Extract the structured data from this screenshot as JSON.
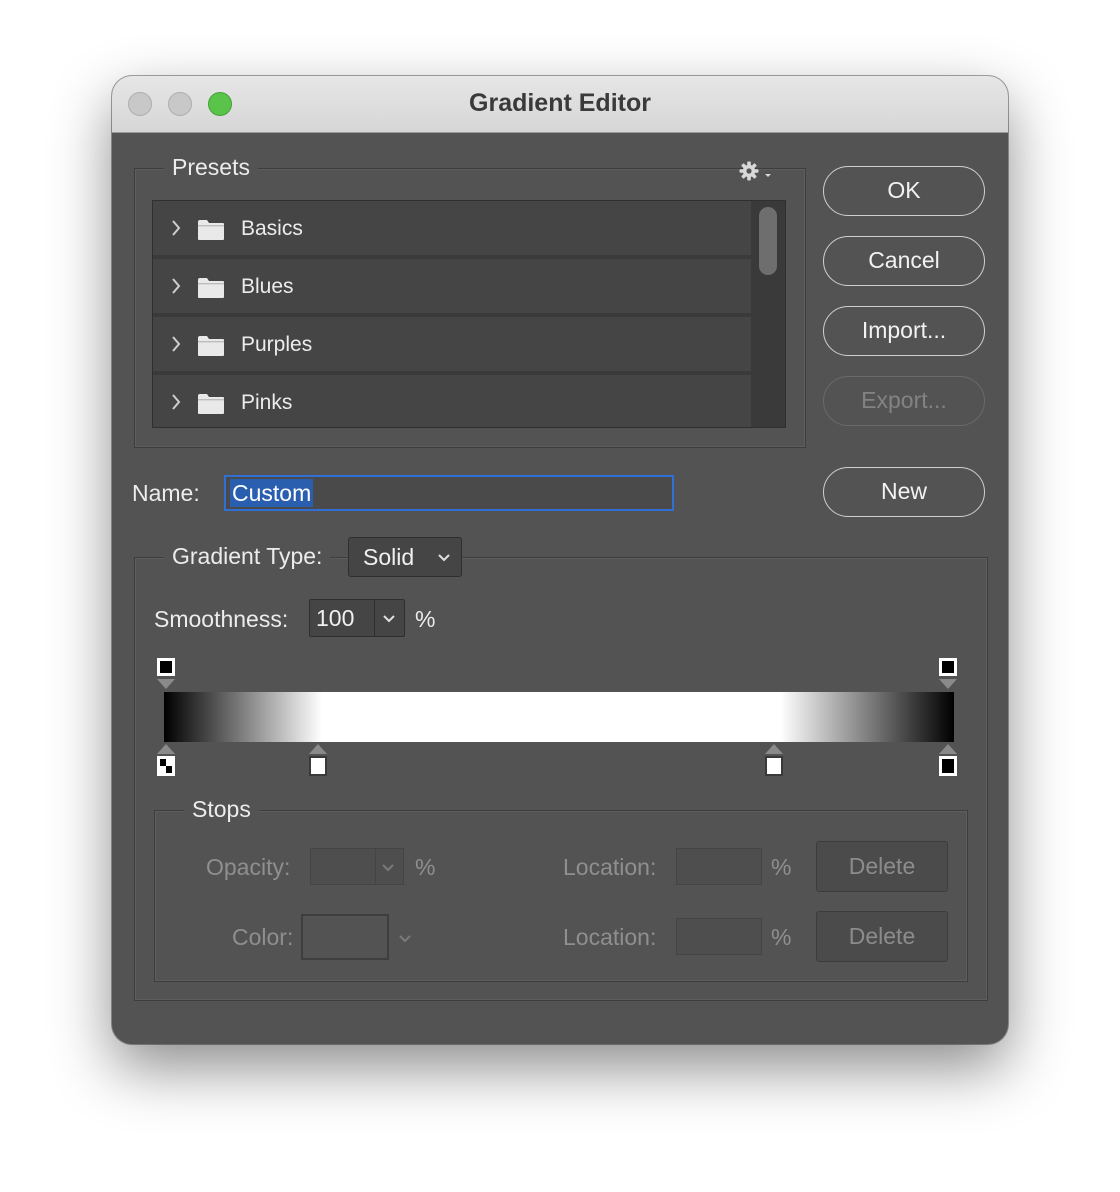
{
  "window": {
    "title": "Gradient Editor"
  },
  "presets": {
    "legend": "Presets",
    "items": [
      {
        "label": "Basics"
      },
      {
        "label": "Blues"
      },
      {
        "label": "Purples"
      },
      {
        "label": "Pinks"
      }
    ]
  },
  "buttons": {
    "ok": "OK",
    "cancel": "Cancel",
    "import": "Import...",
    "export": "Export...",
    "new": "New"
  },
  "name": {
    "label": "Name:",
    "value": "Custom"
  },
  "gradient_type": {
    "label": "Gradient Type:",
    "value": "Solid"
  },
  "smoothness": {
    "label": "Smoothness:",
    "value": "100",
    "unit": "%"
  },
  "gradient": {
    "colors": [
      "#000000",
      "#ffffff"
    ],
    "color_stops": [
      0,
      20,
      78,
      100
    ],
    "opacity_stops": [
      0,
      100
    ]
  },
  "stops": {
    "legend": "Stops",
    "opacity_label": "Opacity:",
    "opacity_unit": "%",
    "color_label": "Color:",
    "location_label": "Location:",
    "location_unit": "%",
    "delete_label": "Delete"
  },
  "colors": {
    "panel": "#535353",
    "titlebar": "#dedede",
    "accent": "#2f6fd6"
  }
}
